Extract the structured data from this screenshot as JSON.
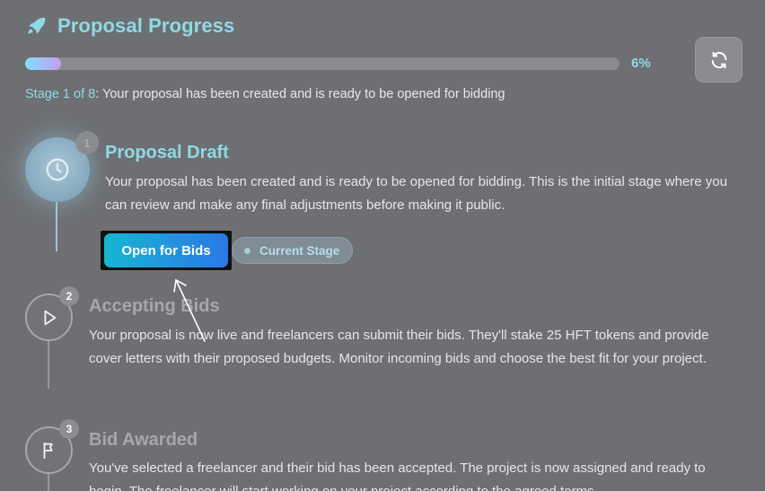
{
  "header": {
    "title": "Proposal Progress",
    "icon": "rocket-icon"
  },
  "progress": {
    "percent_label": "6%",
    "value": 0.06
  },
  "stage_line": {
    "stage_label": "Stage 1 of 8",
    "message": ": Your proposal has been created and is ready to be opened for bidding"
  },
  "refresh_button": {
    "icon": "refresh-icon"
  },
  "steps": [
    {
      "number": "1",
      "title": "Proposal Draft",
      "description": "Your proposal has been created and is ready to be opened for bidding. This is the initial stage where you can review and make any final adjustments before making it public.",
      "icon": "clock-icon",
      "status": "current"
    },
    {
      "number": "2",
      "title": "Accepting Bids",
      "description": "Your proposal is now live and freelancers can submit their bids. They'll stake 25 HFT tokens and provide cover letters with their proposed budgets. Monitor incoming bids and choose the best fit for your project.",
      "icon": "play-icon",
      "status": "upcoming"
    },
    {
      "number": "3",
      "title": "Bid Awarded",
      "description": "You've selected a freelancer and their bid has been accepted. The project is now assigned and ready to begin. The freelancer will start working on your project according to the agreed terms.",
      "icon": "flag-icon",
      "status": "upcoming"
    }
  ],
  "actions": {
    "open_bids_label": "Open for Bids",
    "current_stage_label": "Current Stage"
  },
  "colors": {
    "background": "#6e6f72",
    "accent": "#8fd9e6",
    "button_gradient_start": "#16b6d4",
    "button_gradient_end": "#2b78e8"
  }
}
